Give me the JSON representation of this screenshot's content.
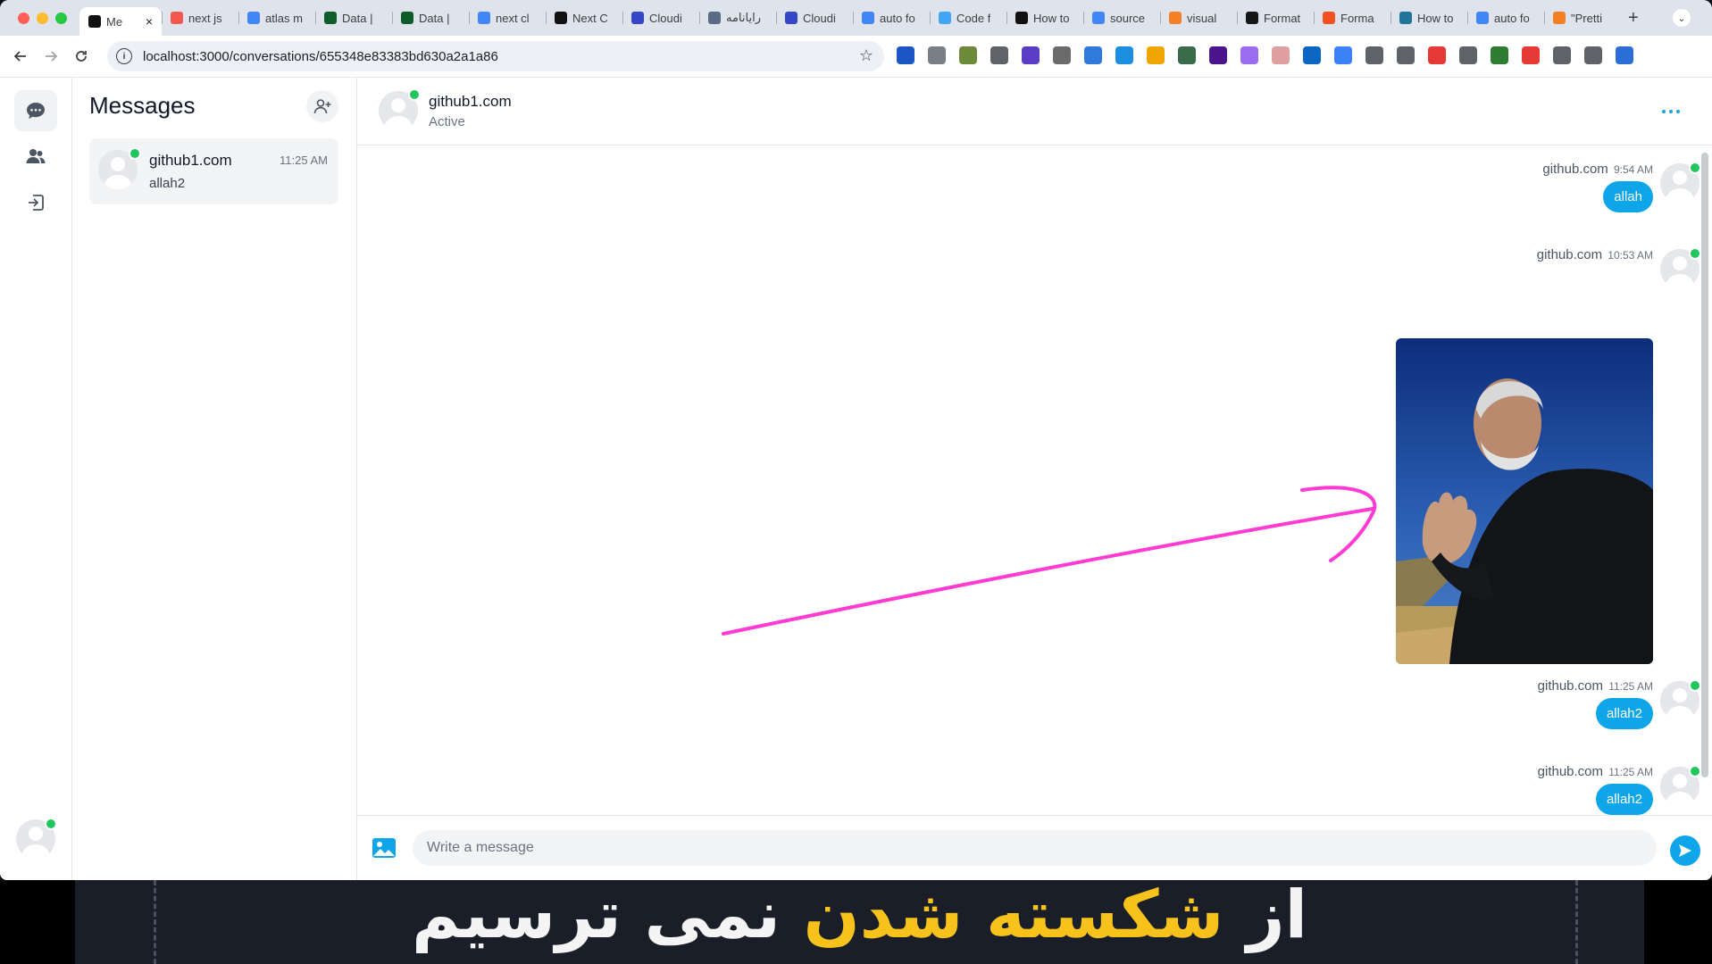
{
  "browser": {
    "tabs": [
      {
        "label": "Me",
        "icon_color": "#111111",
        "active": true
      },
      {
        "label": "next js",
        "icon_color": "#f4574d"
      },
      {
        "label": "atlas m",
        "icon_color": "#4285f4"
      },
      {
        "label": "Data |",
        "icon_color": "#0f5d2a"
      },
      {
        "label": "Data |",
        "icon_color": "#0f5d2a"
      },
      {
        "label": "next cl",
        "icon_color": "#4285f4"
      },
      {
        "label": "Next C",
        "icon_color": "#111111"
      },
      {
        "label": "Cloudi",
        "icon_color": "#3448c5"
      },
      {
        "label": "رایانامه",
        "icon_color": "#5a6b86"
      },
      {
        "label": "Cloudi",
        "icon_color": "#3448c5"
      },
      {
        "label": "auto fo",
        "icon_color": "#4285f4"
      },
      {
        "label": "Code f",
        "icon_color": "#42a5f5"
      },
      {
        "label": "How to",
        "icon_color": "#111111"
      },
      {
        "label": "source",
        "icon_color": "#4285f4"
      },
      {
        "label": "visual",
        "icon_color": "#f48024"
      },
      {
        "label": "Format",
        "icon_color": "#181717"
      },
      {
        "label": "Forma",
        "icon_color": "#f25022"
      },
      {
        "label": "How to",
        "icon_color": "#21759b"
      },
      {
        "label": "auto fo",
        "icon_color": "#4285f4"
      },
      {
        "label": "\"Pretti",
        "icon_color": "#f48024"
      }
    ],
    "url": "localhost:3000/conversations/655348e83383bd630a2a1a86",
    "extension_colors": [
      "#1a56c4",
      "#7a7f87",
      "#6d8a3a",
      "#5f6368",
      "#5b3cc4",
      "#6b6b6b",
      "#2f7bdc",
      "#1d8fe0",
      "#f0a500",
      "#3a6b4a",
      "#4a148c",
      "#9b6cf0",
      "#e0a0a0",
      "#0a66c2",
      "#3b82f6",
      "#5f6368",
      "#5f6368",
      "#e53935",
      "#5f6368",
      "#2e7d32",
      "#e53935",
      "#5f6368",
      "#5f6368",
      "#2b6fd6"
    ]
  },
  "sidebar": {
    "icons": [
      "chat-icon",
      "users-icon",
      "logout-icon"
    ]
  },
  "conversations": {
    "title": "Messages",
    "items": [
      {
        "name": "github1.com",
        "time": "11:25 AM",
        "preview": "allah2"
      }
    ]
  },
  "chat": {
    "contact_name": "github1.com",
    "status": "Active",
    "messages": [
      {
        "sender": "github.com",
        "time": "9:54 AM",
        "text": "allah"
      },
      {
        "sender": "github.com",
        "time": "10:53 AM",
        "image": "portrait-photo"
      },
      {
        "sender": "github.com",
        "time": "11:25 AM",
        "text": "allah2"
      },
      {
        "sender": "github.com",
        "time": "11:25 AM",
        "text": "allah2"
      }
    ],
    "composer_placeholder": "Write a message"
  },
  "colors": {
    "accent": "#0ea5e9",
    "online": "#22c55e",
    "annotation": "#ff3bd4"
  },
  "backdrop": {
    "caption_start": "از",
    "caption_highlight": "شکسته شدن",
    "caption_end": "نمی ترسیم"
  }
}
